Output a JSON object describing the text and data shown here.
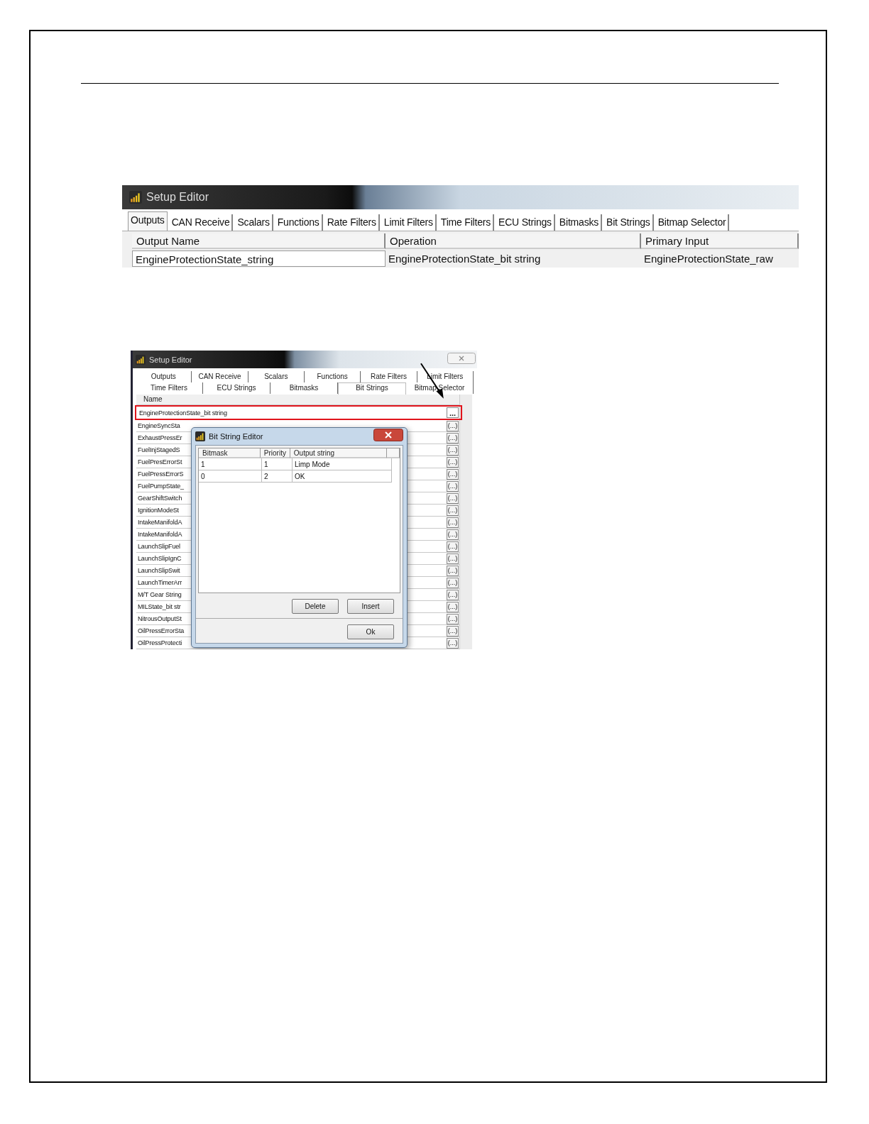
{
  "setup_editor_top": {
    "title": "Setup Editor",
    "tabs": [
      {
        "label": "Outputs",
        "selected": true
      },
      {
        "label": "CAN Receive",
        "selected": false
      },
      {
        "label": "Scalars",
        "selected": false
      },
      {
        "label": "Functions",
        "selected": false
      },
      {
        "label": "Rate Filters",
        "selected": false
      },
      {
        "label": "Limit Filters",
        "selected": false
      },
      {
        "label": "Time Filters",
        "selected": false
      },
      {
        "label": "ECU Strings",
        "selected": false
      },
      {
        "label": "Bitmasks",
        "selected": false
      },
      {
        "label": "Bit Strings",
        "selected": false
      },
      {
        "label": "Bitmap Selector",
        "selected": false
      }
    ],
    "columns": [
      "Output Name",
      "Operation",
      "Primary Input"
    ],
    "rows": [
      [
        "EngineProtectionState_string",
        "EngineProtectionState_bit string",
        "EngineProtectionState_raw"
      ]
    ]
  },
  "setup_editor_bottom": {
    "title": "Setup Editor",
    "tab_rows": [
      [
        {
          "label": "Outputs",
          "selected": false
        },
        {
          "label": "CAN Receive",
          "selected": false
        },
        {
          "label": "Scalars",
          "selected": false
        },
        {
          "label": "Functions",
          "selected": false
        },
        {
          "label": "Rate Filters",
          "selected": false
        },
        {
          "label": "Limit Filters",
          "selected": false
        }
      ],
      [
        {
          "label": "Time Filters",
          "selected": false
        },
        {
          "label": "ECU Strings",
          "selected": false
        },
        {
          "label": "Bitmasks",
          "selected": false
        },
        {
          "label": "Bit Strings",
          "selected": true
        },
        {
          "label": "Bitmap Selector",
          "selected": false
        }
      ]
    ],
    "column": "Name",
    "rows": [
      {
        "name": "EngineProtectionState_bit string",
        "button": "...",
        "highlighted": true
      },
      {
        "name": "EngineSyncSta",
        "button": "(...)",
        "highlighted": false
      },
      {
        "name": "ExhaustPressEr",
        "button": "(...)",
        "highlighted": false
      },
      {
        "name": "FuelInjStagedS",
        "button": "(...)",
        "highlighted": false
      },
      {
        "name": "FuelPresErrorSt",
        "button": "(...)",
        "highlighted": false
      },
      {
        "name": "FuelPressErrorS",
        "button": "(...)",
        "highlighted": false
      },
      {
        "name": "FuelPumpState_",
        "button": "(...)",
        "highlighted": false
      },
      {
        "name": "GearShiftSwitch",
        "button": "(...)",
        "highlighted": false
      },
      {
        "name": "IgnitionModeSt",
        "button": "(...)",
        "highlighted": false
      },
      {
        "name": "IntakeManifoldA",
        "button": "(...)",
        "highlighted": false
      },
      {
        "name": "IntakeManifoldA",
        "button": "(...)",
        "highlighted": false
      },
      {
        "name": "LaunchSlipFuel",
        "button": "(...)",
        "highlighted": false
      },
      {
        "name": "LaunchSlipIgnC",
        "button": "(...)",
        "highlighted": false
      },
      {
        "name": "LaunchSlipSwit",
        "button": "(...)",
        "highlighted": false
      },
      {
        "name": "LaunchTimerArr",
        "button": "(...)",
        "highlighted": false
      },
      {
        "name": "M/T Gear String",
        "button": "(...)",
        "highlighted": false
      },
      {
        "name": "MILState_bit str",
        "button": "(...)",
        "highlighted": false
      },
      {
        "name": "NitrousOutputSt",
        "button": "(...)",
        "highlighted": false
      },
      {
        "name": "OilPressErrorSta",
        "button": "(...)",
        "highlighted": false
      },
      {
        "name": "OilPressProtecti",
        "button": "(...)",
        "highlighted": false
      }
    ]
  },
  "bit_string_editor": {
    "title": "Bit String Editor",
    "columns": [
      "Bitmask",
      "Priority",
      "Output string"
    ],
    "rows": [
      [
        "1",
        "1",
        "Limp Mode"
      ],
      [
        "0",
        "2",
        "OK"
      ]
    ],
    "buttons": [
      "Delete",
      "Insert",
      "Ok"
    ]
  }
}
